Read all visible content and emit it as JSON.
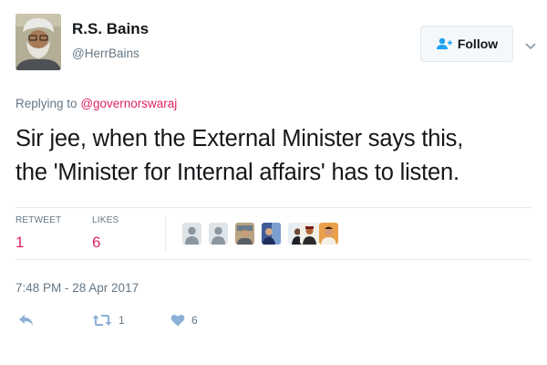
{
  "user": {
    "display_name": "R.S. Bains",
    "handle": "@HerrBains",
    "avatar_icon": "profile-photo"
  },
  "follow": {
    "label": "Follow",
    "icon": "add-user-icon"
  },
  "reply_context": {
    "prefix": "Replying to",
    "mention": "@governorswaraj"
  },
  "tweet": {
    "line1": "Sir jee, when the External Minister says this,",
    "line2": "the 'Minister for Internal affairs' has to listen."
  },
  "stats": {
    "retweet_label": "RETWEET",
    "retweet_count": "1",
    "likes_label": "LIKES",
    "likes_count": "6"
  },
  "likers": [
    {
      "name": "liker-1",
      "icon": "default-avatar"
    },
    {
      "name": "liker-2",
      "icon": "default-avatar"
    },
    {
      "name": "liker-3",
      "icon": "profile-photo"
    },
    {
      "name": "liker-4",
      "icon": "profile-photo"
    },
    {
      "name": "liker-5",
      "icon": "profile-photo"
    },
    {
      "name": "liker-6",
      "icon": "profile-photo"
    },
    {
      "name": "liker-7",
      "icon": "profile-photo"
    }
  ],
  "timestamp": "7:48 PM - 28 Apr 2017",
  "actions": {
    "reply_icon": "reply-icon",
    "retweet_icon": "retweet-icon",
    "retweet_count": "1",
    "like_icon": "heart-icon",
    "like_count": "6"
  },
  "colors": {
    "accent_red": "#e0245e",
    "muted_text": "#657786",
    "action_blue": "#8cb0d6"
  }
}
